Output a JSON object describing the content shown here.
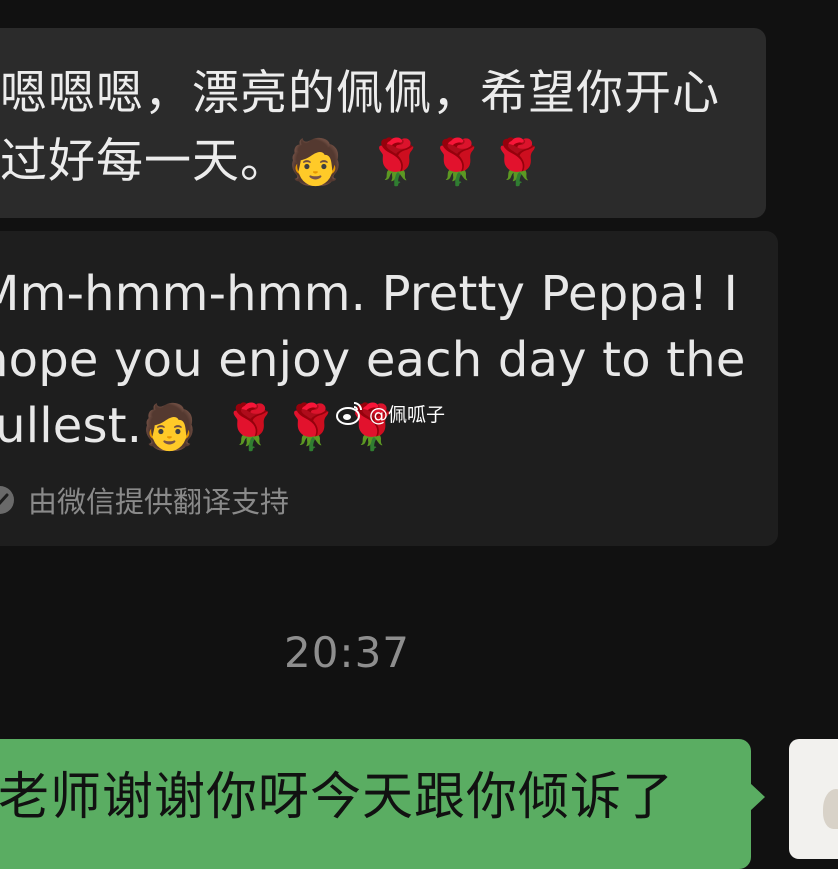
{
  "incoming_message": {
    "text": "嗯嗯嗯，漂亮的佩佩，希望你开心过好每一天。",
    "emojis": "🧑 🌹🌹🌹"
  },
  "translation": {
    "text": "Mm-hmm-hmm. Pretty Peppa! I hope you enjoy each day to the fullest.",
    "emojis": "🧑 🌹🌹🌹",
    "footer": "由微信提供翻译支持",
    "footer_icon": "check-circle-icon"
  },
  "watermark": {
    "text": "@佩呱子",
    "icon": "weibo-icon"
  },
  "timestamp": "20:37",
  "outgoing_message": {
    "text": "老师谢谢你呀今天跟你倾诉了"
  },
  "avatar": {
    "icon": "avatar"
  },
  "colors": {
    "background": "#111111",
    "incoming_bubble": "#2b2b2b",
    "translation_card": "#1e1e1e",
    "outgoing_bubble": "#5aad62",
    "muted_text": "#8e8e8e"
  }
}
